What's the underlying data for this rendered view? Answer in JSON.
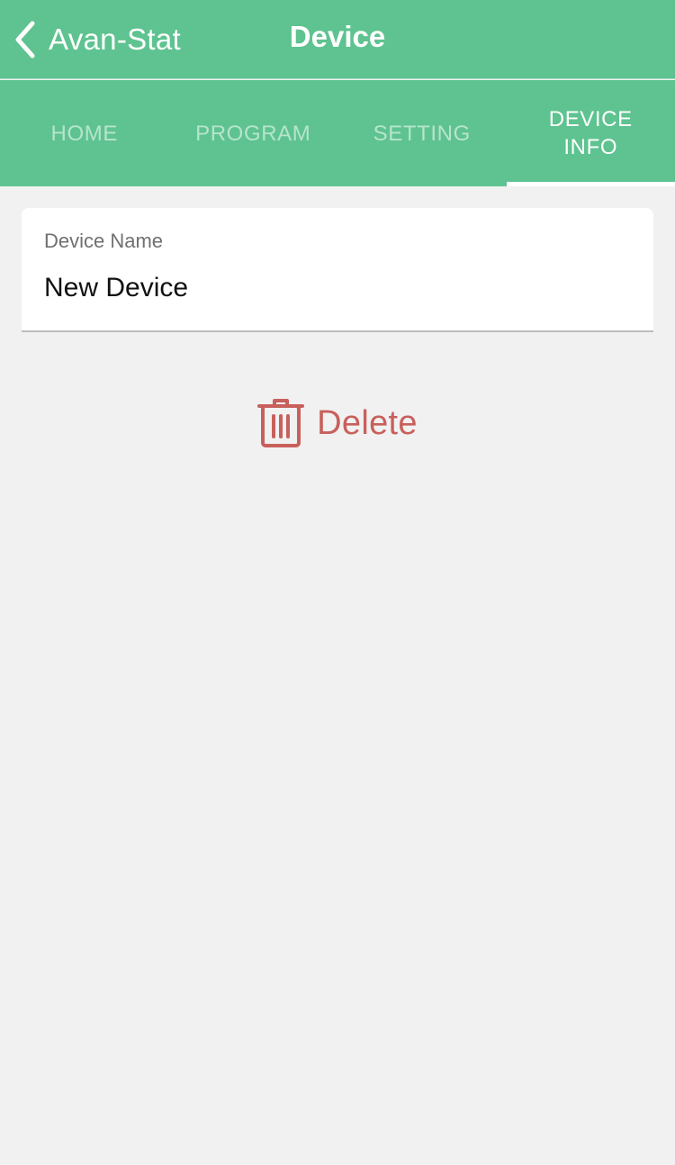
{
  "navbar": {
    "back_label": "Avan-Stat",
    "title": "Device",
    "back_icon": "chevron-left-icon"
  },
  "tabs": [
    {
      "label": "HOME",
      "active": false
    },
    {
      "label": "PROGRAM",
      "active": false
    },
    {
      "label": "SETTING",
      "active": false
    },
    {
      "label": "DEVICE\nINFO",
      "active": true
    }
  ],
  "device_name": {
    "label": "Device Name",
    "value": "New Device"
  },
  "delete": {
    "label": "Delete",
    "icon": "trash-icon"
  },
  "colors": {
    "accent": "#5ec390",
    "danger": "#c8605c",
    "background": "#f1f1f1"
  }
}
